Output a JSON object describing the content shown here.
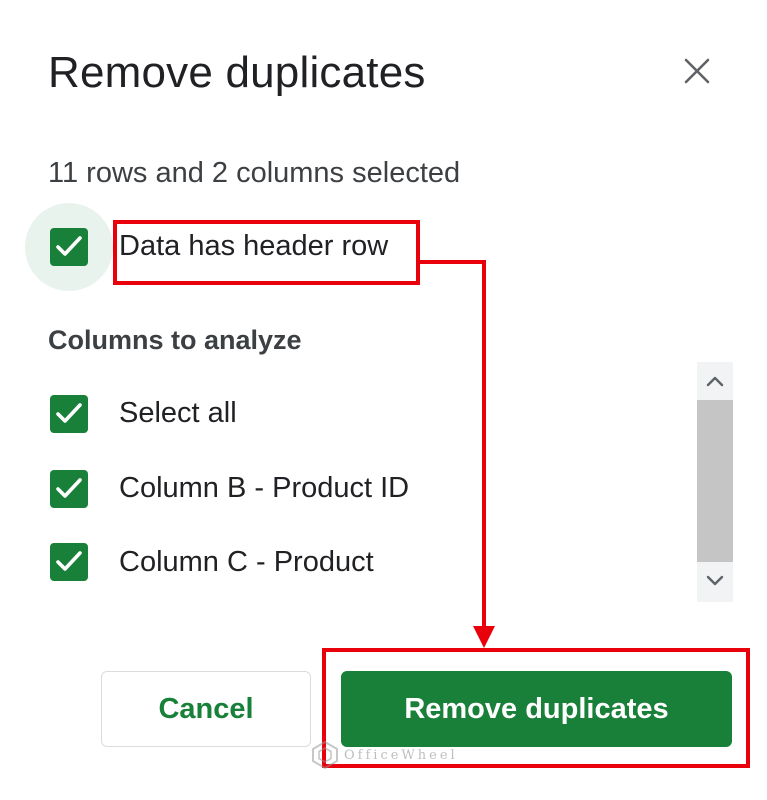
{
  "dialog": {
    "title": "Remove duplicates",
    "close_icon": "close-icon",
    "selection_info": "11 rows and 2 columns selected",
    "header_row": {
      "label": "Data has header row",
      "checked": true
    },
    "columns_heading": "Columns to analyze",
    "columns": [
      {
        "label": "Select all",
        "checked": true
      },
      {
        "label": "Column B - Product ID",
        "checked": true
      },
      {
        "label": "Column C - Product",
        "checked": true
      }
    ],
    "scrollbar": {
      "up_icon": "chevron-up-icon",
      "down_icon": "chevron-down-icon"
    },
    "buttons": {
      "cancel": "Cancel",
      "confirm": "Remove duplicates"
    }
  },
  "annotation": {
    "color": "#e8000b",
    "arrow_icon": "arrow-down-icon"
  },
  "watermark": {
    "text": "OfficeWheel",
    "logo_icon": "officewheel-logo-icon"
  },
  "colors": {
    "accent": "#188038",
    "halo": "#e9f3ed",
    "annotation": "#e8000b"
  }
}
